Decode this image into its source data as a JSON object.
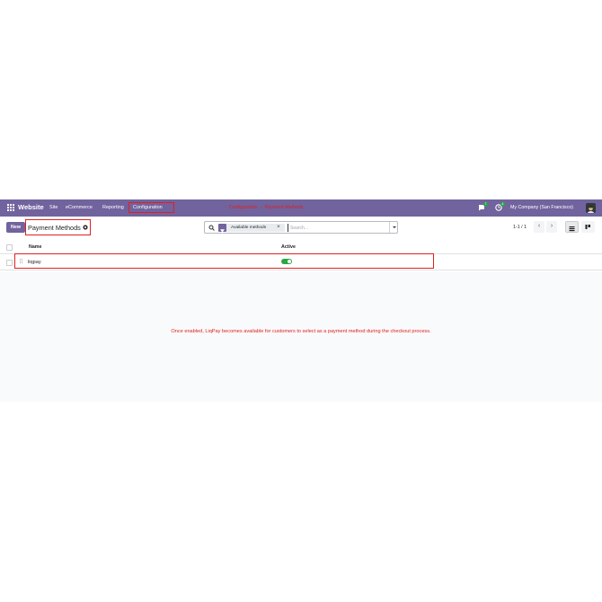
{
  "navbar": {
    "app_name": "Website",
    "menu": [
      "Site",
      "eCommerce",
      "Reporting",
      "Configuration"
    ],
    "company": "My Company (San Francisco)",
    "messages_badge": "7",
    "activity_badge": "4",
    "bg_color": "#71639e"
  },
  "annotations": {
    "breadcrumb_hint": "Configuration → Payment Methods",
    "footer_note": "Once enabled, LiqPay becomes available for customers to select as a payment method during the checkout process.",
    "color": "#e02020"
  },
  "control_panel": {
    "new_label": "New",
    "title": "Payment Methods",
    "search": {
      "facet_label": "Available methods",
      "placeholder": "Search..."
    },
    "pager": "1-1 / 1"
  },
  "list": {
    "columns": [
      "Name",
      "Active"
    ],
    "rows": [
      {
        "name": "liqpay",
        "active": true
      }
    ]
  }
}
